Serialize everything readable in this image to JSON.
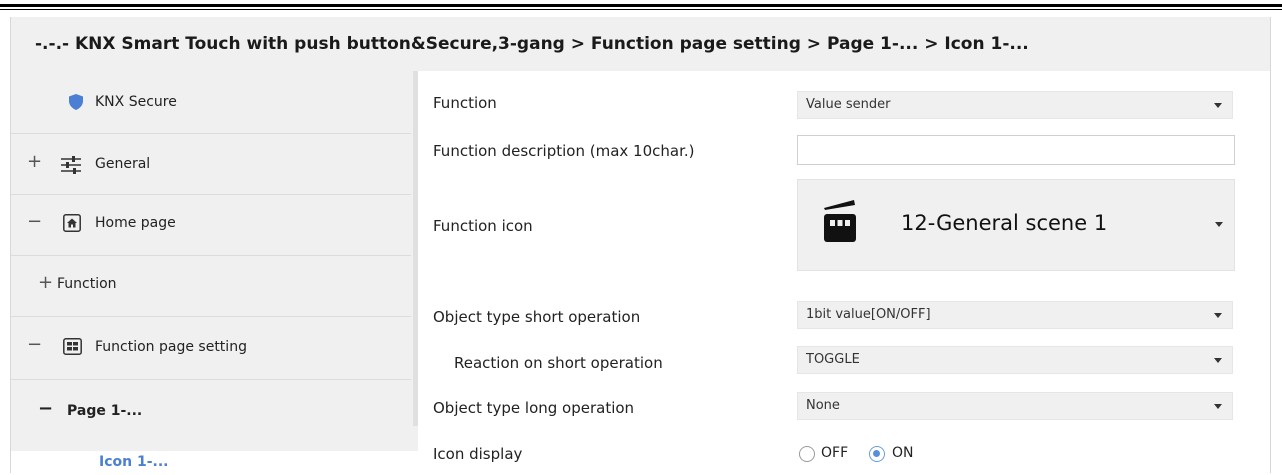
{
  "breadcrumb": "-.-.- KNX Smart Touch with push button&Secure,3-gang > Function page setting > Page 1-... > Icon 1-...",
  "sidebar": {
    "items": [
      {
        "sign": "",
        "label": "KNX Secure",
        "icon": "shield-icon"
      },
      {
        "sign": "+",
        "label": "General",
        "icon": "sliders-icon"
      },
      {
        "sign": "−",
        "label": "Home page",
        "icon": "home-icon"
      },
      {
        "sign": "+",
        "label": "Function",
        "icon": ""
      },
      {
        "sign": "−",
        "label": "Function page setting",
        "icon": "grid-icon"
      },
      {
        "sign": "−",
        "label": "Page 1-...",
        "icon": ""
      },
      {
        "sign": "",
        "label": "Icon 1-...",
        "icon": ""
      }
    ],
    "accent_color": "#4a7fd4"
  },
  "form": {
    "function": {
      "label": "Function",
      "value": "Value sender"
    },
    "description": {
      "label": "Function description (max 10char.)",
      "value": ""
    },
    "icon": {
      "label": "Function icon",
      "value": "12-General scene 1",
      "icon": "clapperboard-icon"
    },
    "short_type": {
      "label": "Object type short operation",
      "value": "1bit value[ON/OFF]"
    },
    "short_reaction": {
      "label": "Reaction on short operation",
      "value": "TOGGLE"
    },
    "long_type": {
      "label": "Object type long operation",
      "value": "None"
    },
    "display": {
      "label": "Icon display",
      "off": "OFF",
      "on": "ON",
      "selected": "ON"
    }
  }
}
